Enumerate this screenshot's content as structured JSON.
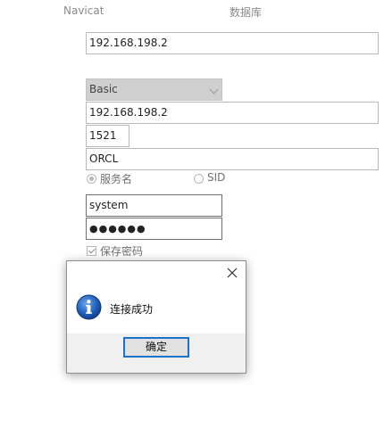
{
  "tabs": {
    "left": "Navicat",
    "right": "数据库"
  },
  "form": {
    "host_top": "192.168.198.2",
    "connection_type": "Basic",
    "host": "192.168.198.2",
    "port": "1521",
    "service": "ORCL",
    "radio_service_name": "服务名",
    "radio_sid": "SID",
    "username": "system",
    "password": "●●●●●●",
    "save_password": "保存密码"
  },
  "dialog": {
    "message": "连接成功",
    "ok_label": "确定",
    "icon": "info-icon",
    "close_icon": "close-icon"
  },
  "colors": {
    "accent": "#1a73c9",
    "info_icon": "#1f5fb4"
  }
}
